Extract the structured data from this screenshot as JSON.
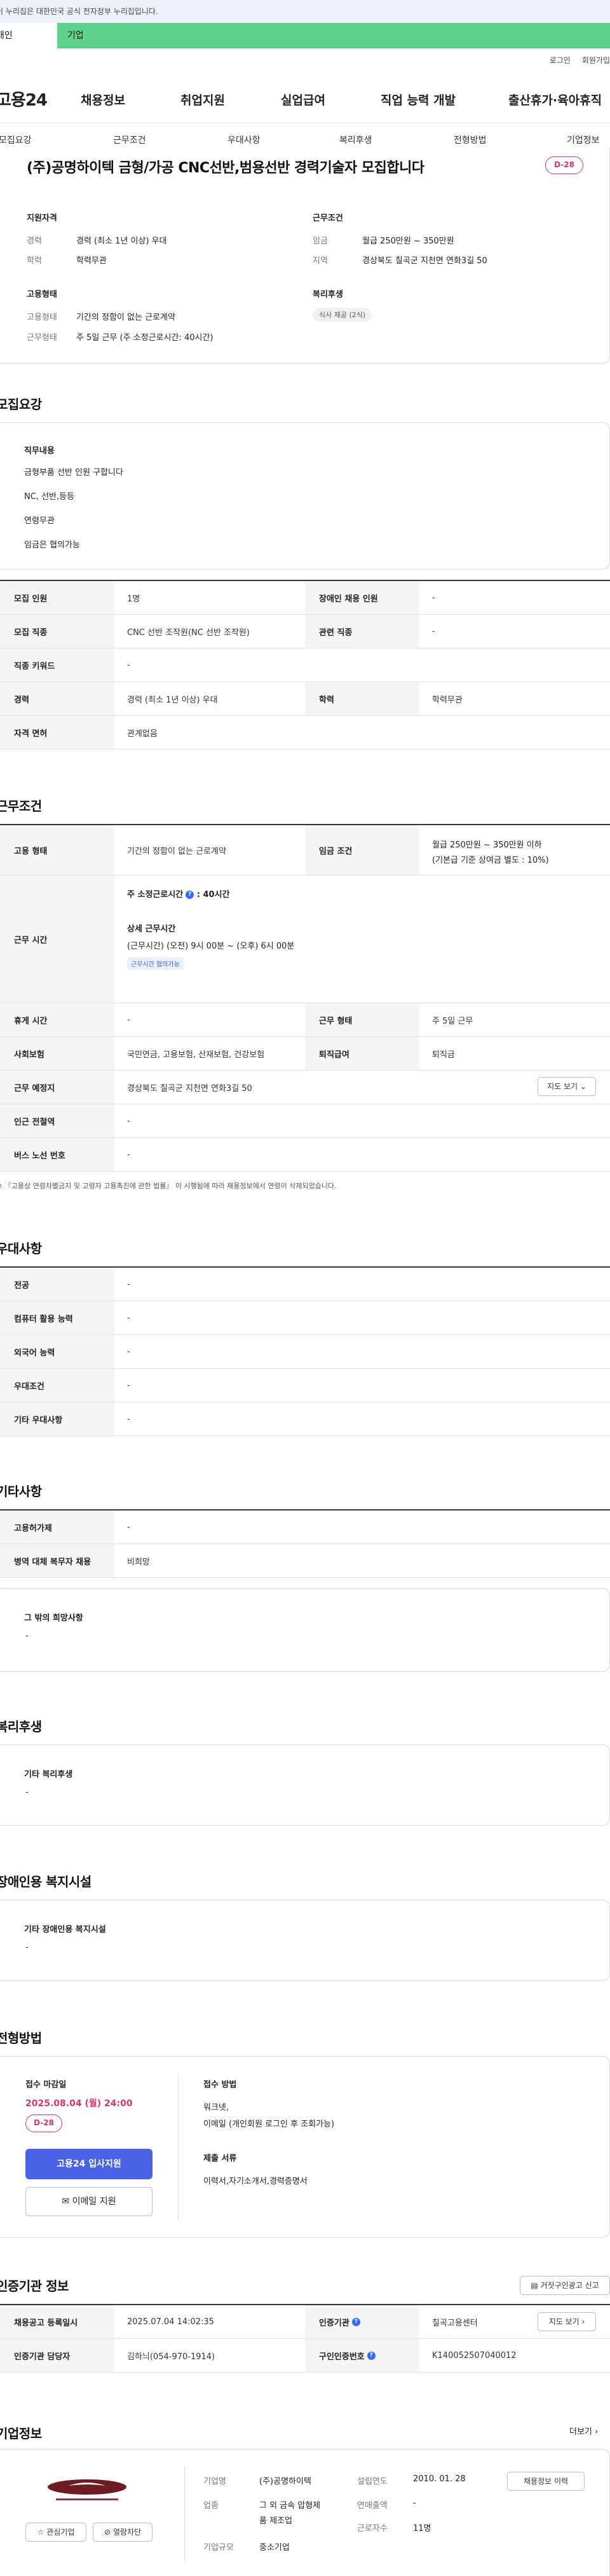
{
  "gov_banner": "이 누리집은 대한민국 공식 전자정부 누리집입니다.",
  "user_tabs": {
    "individual": "개인",
    "corporate": "기업"
  },
  "top_links": {
    "login": "로그인",
    "join": "회원가입"
  },
  "logo": "고용24",
  "gnb": [
    "채용정보",
    "취업지원",
    "실업급여",
    "직업 능력 개발",
    "출산휴가·육아휴직"
  ],
  "subnav": [
    "모집요강",
    "근무조건",
    "우대사항",
    "복리후생",
    "전형방법",
    "기업정보"
  ],
  "job": {
    "title": "(주)공명하이텍 금형/가공 CNC선반,범용선반 경력기술자 모집합니다",
    "dday": "D-28",
    "qualification_heading": "지원자격",
    "experience_label": "경력",
    "experience_value": "경력 (최소 1년 이상) 우대",
    "education_label": "학력",
    "education_value": "학력무관",
    "conditions_heading": "근무조건",
    "wage_label": "임금",
    "wage_value": "월급 250만원 ~ 350만원",
    "region_label": "지역",
    "region_value": "경상북도 칠곡군 지천면 연화3길 50",
    "employment_heading": "고용형태",
    "emptype_label": "고용형태",
    "emptype_value": "기간의 정함이 없는 근로계약",
    "worktype_label": "근무형태",
    "worktype_value": "주 5일 근무 (주 소정근로시간: 40시간)",
    "welfare_heading": "복리후생",
    "welfare_pill": "식사 제공 (2식)"
  },
  "recruit": {
    "heading": "모집요강",
    "duty_heading": "직무내용",
    "duty_lines": [
      "금형부품 선반 인원 구합니다",
      "NC, 선반,등등",
      "연령무관",
      "임금은 협의가능"
    ],
    "rows": [
      {
        "k1": "모집 인원",
        "v1": "1명",
        "k2": "장애인 채용 인원",
        "v2": "-"
      },
      {
        "k1": "모집 직종",
        "v1": "CNC 선반 조작원(NC 선반 조작원)",
        "k2": "관련 직종",
        "v2": "-"
      },
      {
        "k1": "직종 키워드",
        "v1": "-"
      },
      {
        "k1": "경력",
        "v1": "경력 (최소 1년 이상) 우대",
        "k2": "학력",
        "v2": "학력무관"
      },
      {
        "k1": "자격 면허",
        "v1": "관계없음"
      }
    ]
  },
  "work": {
    "heading": "근무조건",
    "emp_type_label": "고용 형태",
    "emp_type_value": "기간의 정함이 없는 근로계약",
    "wage_label": "임금 조건",
    "wage_line1": "월급 250만원 ~ 350만원 이하",
    "wage_line2": "(기본급 기준 상여금 별도 : 10%)",
    "hours_label": "근무 시간",
    "hours_standard": "주 소정근로시간",
    "hours_standard_value": ": 40시간",
    "hours_detail_title": "상세 근무시간",
    "hours_detail": "(근무시간) (오전) 9시 00분 ~ (오후) 6시 00분",
    "hours_tag": "근무시간 협의가능",
    "holiday_label": "휴게 시간",
    "holiday_value": "-",
    "worktype_label": "근무 형태",
    "worktype_value": "주 5일 근무",
    "insurance_label": "사회보험",
    "insurance_value": "국민연금, 고용보험, 산재보험, 건강보험",
    "retire_label": "퇴직급여",
    "retire_value": "퇴직금",
    "place_label": "근무 예정지",
    "place_value": "경상북도 칠곡군 지천면 연화3길 50",
    "map_btn": "지도 보기",
    "subway_label": "인근 전철역",
    "subway_value": "-",
    "bus_label": "버스 노선 번호",
    "bus_value": "-",
    "note": "※ 『고용상 연령차별금지 및 고령자 고용촉진에 관한 법률』 이 시행됨에 따라 채용정보에서 연령이 삭제되었습니다."
  },
  "prefer": {
    "heading": "우대사항",
    "rows": [
      {
        "k": "전공",
        "v": "-"
      },
      {
        "k": "컴퓨터 활용 능력",
        "v": "-"
      },
      {
        "k": "외국어 능력",
        "v": "-"
      },
      {
        "k": "우대조건",
        "v": "-"
      },
      {
        "k": "기타 우대사항",
        "v": "-"
      }
    ]
  },
  "etc": {
    "heading": "기타사항",
    "rows": [
      {
        "k": "고용허가제",
        "v": "-"
      },
      {
        "k": "병역 대체 복무자 채용",
        "v": "비희망"
      }
    ],
    "other_title": "그 밖의 희망사항",
    "other_value": "-"
  },
  "welfare": {
    "heading": "복리후생",
    "box_title": "기타 복리후생",
    "box_value": "-"
  },
  "disability": {
    "heading": "장애인용 복지시설",
    "box_title": "기타 장애인용 복지시설",
    "box_value": "-"
  },
  "selection": {
    "heading": "전형방법",
    "deadline_label": "접수 마감일",
    "deadline_value": "2025.08.04 (월) 24:00",
    "dday": "D-28",
    "apply_btn": "고용24 입사지원",
    "email_btn": "이메일 지원",
    "method_label": "접수 방법",
    "method_line1": "워크넷,",
    "method_line2": "이메일 (개인회원 로그인 후 조회가능)",
    "docs_label": "제출 서류",
    "docs_value": "이력서,자기소개서,경력증명서"
  },
  "cert": {
    "heading": "인증기관 정보",
    "report_btn": "거짓구인광고 신고",
    "reg_label": "채용공고 등록일시",
    "reg_value": "2025.07.04 14:02:35",
    "agency_label": "인증기관",
    "agency_value": "칠곡고용센터",
    "map_btn": "지도 보기",
    "manager_label": "인증기관 담당자",
    "manager_value": "김하늬(054-970-1914)",
    "reqno_label": "구인인증번호",
    "reqno_value": "K140052507040012"
  },
  "company": {
    "heading": "기업정보",
    "more": "더보기",
    "interest_btn": "관심기업",
    "block_btn": "열람차단",
    "name_label": "기업명",
    "name_value": "(주)공명하이텍",
    "industry_label": "업종",
    "industry_line1": "그 외 금속 압형제",
    "industry_line2": "품 제조업",
    "size_label": "기업규모",
    "size_value": "중소기업",
    "founded_label": "설립연도",
    "founded_value": "2010. 01. 28",
    "sales_label": "연매출액",
    "sales_value": "-",
    "employees_label": "근로자수",
    "employees_value": "11명",
    "jobs_btn": "채용정보 이력"
  },
  "colors": {
    "accent_green": "#5fd38b",
    "dday_pink": "#e0336a",
    "primary_blue": "#4a63e6"
  }
}
